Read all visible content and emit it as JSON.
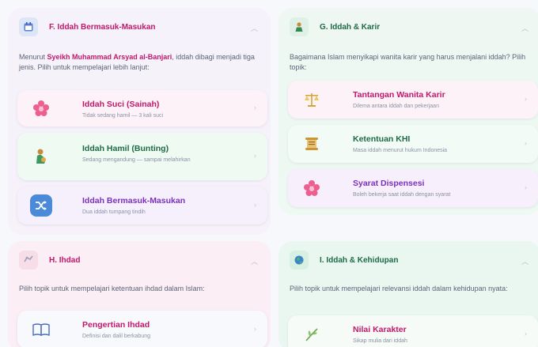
{
  "colors": {
    "pink": "#c2186b",
    "green": "#1d6b45",
    "purple": "#7b2fbf",
    "navy": "#2b3a55"
  },
  "section_f": {
    "icon": "calendar-icon",
    "title": "F. Iddah Bermasuk-Masukan",
    "desc_pre": "Menurut ",
    "desc_name": "Syeikh Muhammad Arsyad al-Banjari",
    "desc_post": ", iddah dibagi menjadi tiga jenis. Pilih untuk mempelajari lebih lanjut:",
    "items": [
      {
        "icon": "flower-icon",
        "title": "Iddah Suci (Sainah)",
        "subtitle": "Tidak sedang hamil — 3 kali suci"
      },
      {
        "icon": "pregnant-woman-icon",
        "title": "Iddah Hamil (Bunting)",
        "subtitle": "Sedang mengandung — sampai melahirkan"
      },
      {
        "icon": "shuffle-icon",
        "title": "Iddah Bermasuk-Masukan",
        "subtitle": "Dua iddah tumpang tindih"
      }
    ]
  },
  "section_g": {
    "icon": "woman-icon",
    "title": "G. Iddah & Karir",
    "desc": "Bagaimana Islam menyikapi wanita karir yang harus menjalani iddah? Pilih topik:",
    "items": [
      {
        "icon": "scale-icon",
        "title": "Tantangan Wanita Karir",
        "subtitle": "Dilema antara iddah dan pekerjaan"
      },
      {
        "icon": "scroll-icon",
        "title": "Ketentuan KHI",
        "subtitle": "Masa iddah menurut hukum Indonesia"
      },
      {
        "icon": "flower-icon",
        "title": "Syarat Dispensesi",
        "subtitle": "Boleh bekerja saat iddah dengan syarat"
      }
    ]
  },
  "section_h": {
    "icon": "ribbon-icon",
    "title": "H. Ihdad",
    "desc": "Pilih topik untuk mempelajari ketentuan ihdad dalam Islam:",
    "items": [
      {
        "icon": "book-icon",
        "title": "Pengertian Ihdad",
        "subtitle": "Definisi dan dalil berkabung"
      }
    ]
  },
  "section_i": {
    "icon": "globe-icon",
    "title": "I. Iddah & Kehidupan",
    "desc": "Pilih topik untuk mempelajari relevansi iddah dalam kehidupan nyata:",
    "items": [
      {
        "icon": "herb-icon",
        "title": "Nilai Karakter",
        "subtitle": "Sikap mulia dari iddah"
      }
    ]
  }
}
